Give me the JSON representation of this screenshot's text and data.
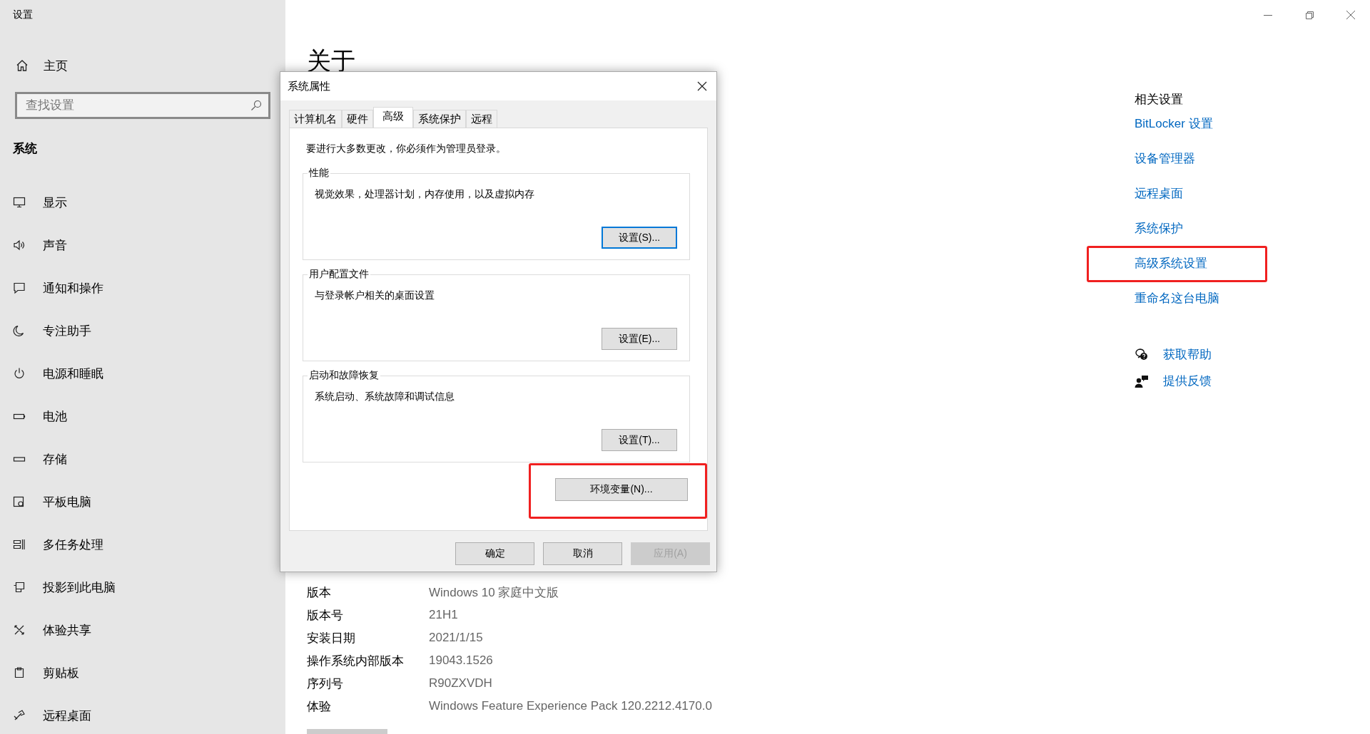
{
  "window": {
    "title": "设置"
  },
  "sidebar": {
    "home": "主页",
    "search": {
      "placeholder": "查找设置"
    },
    "section": "系统",
    "items": [
      {
        "label": "显示"
      },
      {
        "label": "声音"
      },
      {
        "label": "通知和操作"
      },
      {
        "label": "专注助手"
      },
      {
        "label": "电源和睡眠"
      },
      {
        "label": "电池"
      },
      {
        "label": "存储"
      },
      {
        "label": "平板电脑"
      },
      {
        "label": "多任务处理"
      },
      {
        "label": "投影到此电脑"
      },
      {
        "label": "体验共享"
      },
      {
        "label": "剪贴板"
      },
      {
        "label": "远程桌面"
      }
    ]
  },
  "page": {
    "title": "关于",
    "specs": [
      {
        "label": "版本",
        "value": "Windows 10 家庭中文版"
      },
      {
        "label": "版本号",
        "value": "21H1"
      },
      {
        "label": "安装日期",
        "value": "2021/1/15"
      },
      {
        "label": "操作系统内部版本",
        "value": "19043.1526"
      },
      {
        "label": "序列号",
        "value": "R90ZXVDH"
      },
      {
        "label": "体验",
        "value": "Windows Feature Experience Pack 120.2212.4170.0"
      }
    ]
  },
  "related": {
    "title": "相关设置",
    "links": [
      {
        "label": "BitLocker 设置",
        "highlighted": false
      },
      {
        "label": "设备管理器",
        "highlighted": false
      },
      {
        "label": "远程桌面",
        "highlighted": false
      },
      {
        "label": "系统保护",
        "highlighted": false
      },
      {
        "label": "高级系统设置",
        "highlighted": true
      },
      {
        "label": "重命名这台电脑",
        "highlighted": false
      }
    ],
    "help": [
      {
        "label": "获取帮助"
      },
      {
        "label": "提供反馈"
      }
    ]
  },
  "dialog": {
    "title": "系统属性",
    "tabs": [
      {
        "label": "计算机名",
        "selected": false
      },
      {
        "label": "硬件",
        "selected": false
      },
      {
        "label": "高级",
        "selected": true
      },
      {
        "label": "系统保护",
        "selected": false
      },
      {
        "label": "远程",
        "selected": false
      }
    ],
    "notice": "要进行大多数更改，你必须作为管理员登录。",
    "groups": [
      {
        "title": "性能",
        "description": "视觉效果，处理器计划，内存使用，以及虚拟内存",
        "button": "设置(S)...",
        "focused": true
      },
      {
        "title": "用户配置文件",
        "description": "与登录帐户相关的桌面设置",
        "button": "设置(E)...",
        "focused": false
      },
      {
        "title": "启动和故障恢复",
        "description": "系统启动、系统故障和调试信息",
        "button": "设置(T)...",
        "focused": false
      }
    ],
    "env_button": {
      "label": "环境变量(N)...",
      "highlighted": true
    },
    "buttons": [
      {
        "label": "确定",
        "disabled": false
      },
      {
        "label": "取消",
        "disabled": false
      },
      {
        "label": "应用(A)",
        "disabled": true
      }
    ]
  }
}
